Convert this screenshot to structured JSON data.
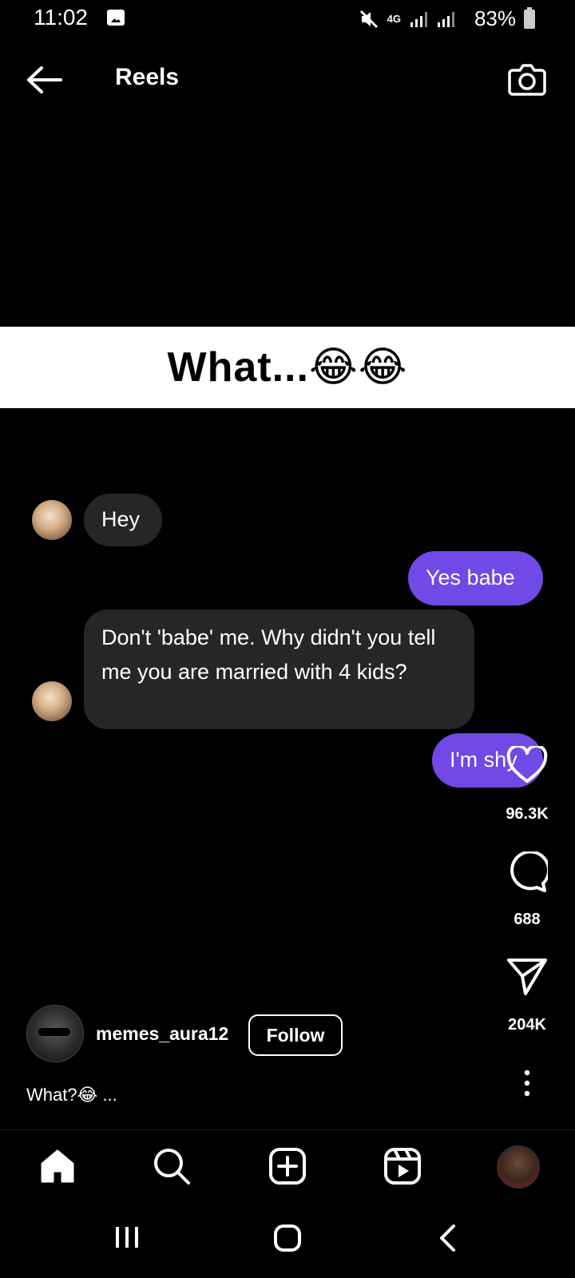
{
  "status_bar": {
    "time": "11:02",
    "network": "4G",
    "battery": "83%"
  },
  "header": {
    "title": "Reels"
  },
  "reel": {
    "caption_overlay": "What...😂😂",
    "messages": [
      {
        "side": "left",
        "text": "Hey"
      },
      {
        "side": "right",
        "text": "Yes babe"
      },
      {
        "side": "left",
        "text": "Don't 'babe' me. Why didn't you tell me you are married with 4 kids?"
      },
      {
        "side": "right",
        "text": "I'm shy"
      }
    ]
  },
  "actions": {
    "likes": "96.3K",
    "comments": "688",
    "shares": "204K"
  },
  "author": {
    "username": "memes_aura12",
    "follow_label": "Follow"
  },
  "post_caption": "What?😂 ...",
  "colors": {
    "background": "#000000",
    "sent_bubble": "#7149e6",
    "received_bubble": "#262626",
    "caption_band": "#ffffff"
  },
  "icons": {
    "back": "arrow-left-icon",
    "camera": "camera-icon",
    "like": "heart-icon",
    "comment": "comment-icon",
    "share": "paper-plane-icon",
    "more": "more-vertical-icon",
    "nav": [
      "home-icon",
      "search-icon",
      "create-icon",
      "reels-icon",
      "profile-avatar"
    ]
  }
}
